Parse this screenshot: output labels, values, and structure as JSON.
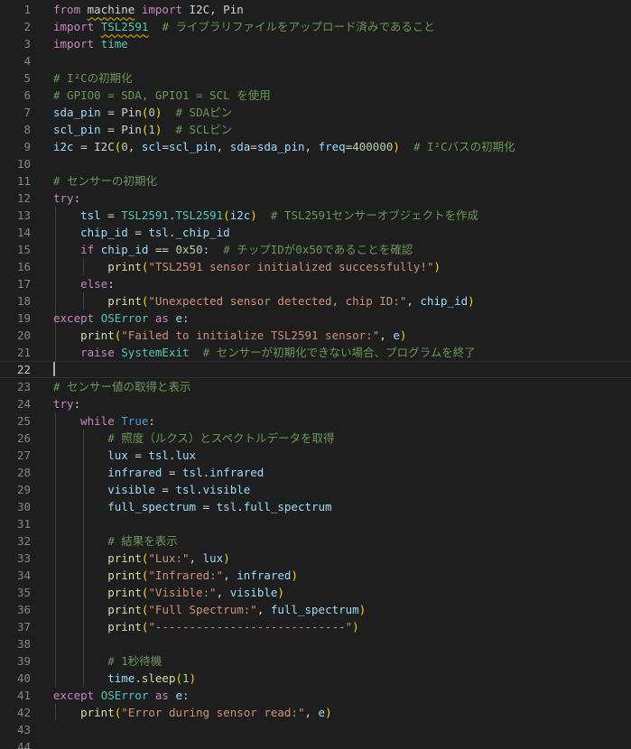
{
  "editor": {
    "language": "python",
    "current_line": 22,
    "lines": [
      [
        [
          "kw",
          "from"
        ],
        [
          "p",
          " "
        ],
        [
          "mod",
          "machine"
        ],
        [
          "p",
          " "
        ],
        [
          "kw",
          "import"
        ],
        [
          "p",
          " I2C, Pin"
        ]
      ],
      [
        [
          "kw",
          "import"
        ],
        [
          "p",
          " "
        ],
        [
          "err",
          "TSL2591"
        ],
        [
          "p",
          "  "
        ],
        [
          "cmt",
          "# ライブラリファイルをアップロード済みであること"
        ]
      ],
      [
        [
          "kw",
          "import"
        ],
        [
          "p",
          " "
        ],
        [
          "cls",
          "time"
        ]
      ],
      [],
      [
        [
          "cmt",
          "# I²Cの初期化"
        ]
      ],
      [
        [
          "cmt",
          "# GPIO0 = SDA, GPIO1 = SCL を使用"
        ]
      ],
      [
        [
          "var",
          "sda_pin"
        ],
        [
          "p",
          " = Pin"
        ],
        [
          "b1",
          "("
        ],
        [
          "num",
          "0"
        ],
        [
          "b1",
          ")"
        ],
        [
          "p",
          "  "
        ],
        [
          "cmt",
          "# SDAピン"
        ]
      ],
      [
        [
          "var",
          "scl_pin"
        ],
        [
          "p",
          " = Pin"
        ],
        [
          "b1",
          "("
        ],
        [
          "num",
          "1"
        ],
        [
          "b1",
          ")"
        ],
        [
          "p",
          "  "
        ],
        [
          "cmt",
          "# SCLピン"
        ]
      ],
      [
        [
          "var",
          "i2c"
        ],
        [
          "p",
          " = I2C"
        ],
        [
          "b1",
          "("
        ],
        [
          "num",
          "0"
        ],
        [
          "p",
          ", "
        ],
        [
          "var",
          "scl"
        ],
        [
          "p",
          "="
        ],
        [
          "var",
          "scl_pin"
        ],
        [
          "p",
          ", "
        ],
        [
          "var",
          "sda"
        ],
        [
          "p",
          "="
        ],
        [
          "var",
          "sda_pin"
        ],
        [
          "p",
          ", "
        ],
        [
          "var",
          "freq"
        ],
        [
          "p",
          "="
        ],
        [
          "num",
          "400000"
        ],
        [
          "b1",
          ")"
        ],
        [
          "p",
          "  "
        ],
        [
          "cmt",
          "# I²Cバスの初期化"
        ]
      ],
      [],
      [
        [
          "cmt",
          "# センサーの初期化"
        ]
      ],
      [
        [
          "ctl",
          "try"
        ],
        [
          "p",
          ":"
        ]
      ],
      [
        [
          "p",
          "    "
        ],
        [
          "var",
          "tsl"
        ],
        [
          "p",
          " = "
        ],
        [
          "cls",
          "TSL2591"
        ],
        [
          "p",
          "."
        ],
        [
          "cls",
          "TSL2591"
        ],
        [
          "b1",
          "("
        ],
        [
          "var",
          "i2c"
        ],
        [
          "b1",
          ")"
        ],
        [
          "p",
          "  "
        ],
        [
          "cmt",
          "# TSL2591センサーオブジェクトを作成"
        ]
      ],
      [
        [
          "p",
          "    "
        ],
        [
          "var",
          "chip_id"
        ],
        [
          "p",
          " = "
        ],
        [
          "var",
          "tsl"
        ],
        [
          "p",
          "."
        ],
        [
          "var",
          "_chip_id"
        ]
      ],
      [
        [
          "p",
          "    "
        ],
        [
          "ctl",
          "if"
        ],
        [
          "p",
          " "
        ],
        [
          "var",
          "chip_id"
        ],
        [
          "p",
          " == "
        ],
        [
          "num",
          "0x50"
        ],
        [
          "p",
          ":  "
        ],
        [
          "cmt",
          "# チップIDが0x50であることを確認"
        ]
      ],
      [
        [
          "p",
          "        "
        ],
        [
          "fn",
          "print"
        ],
        [
          "b1",
          "("
        ],
        [
          "str",
          "\"TSL2591 sensor initialized successfully!\""
        ],
        [
          "b1",
          ")"
        ]
      ],
      [
        [
          "p",
          "    "
        ],
        [
          "ctl",
          "else"
        ],
        [
          "p",
          ":"
        ]
      ],
      [
        [
          "p",
          "        "
        ],
        [
          "fn",
          "print"
        ],
        [
          "b1",
          "("
        ],
        [
          "str",
          "\"Unexpected sensor detected, chip ID:\""
        ],
        [
          "p",
          ", "
        ],
        [
          "var",
          "chip_id"
        ],
        [
          "b1",
          ")"
        ]
      ],
      [
        [
          "ctl",
          "except"
        ],
        [
          "p",
          " "
        ],
        [
          "cls",
          "OSError"
        ],
        [
          "p",
          " "
        ],
        [
          "ctl",
          "as"
        ],
        [
          "p",
          " "
        ],
        [
          "var",
          "e"
        ],
        [
          "p",
          ":"
        ]
      ],
      [
        [
          "p",
          "    "
        ],
        [
          "fn",
          "print"
        ],
        [
          "b1",
          "("
        ],
        [
          "str",
          "\"Failed to initialize TSL2591 sensor:\""
        ],
        [
          "p",
          ", "
        ],
        [
          "var",
          "e"
        ],
        [
          "b1",
          ")"
        ]
      ],
      [
        [
          "p",
          "    "
        ],
        [
          "ctl",
          "raise"
        ],
        [
          "p",
          " "
        ],
        [
          "cls",
          "SystemExit"
        ],
        [
          "p",
          "  "
        ],
        [
          "cmt",
          "# センサーが初期化できない場合、プログラムを終了"
        ]
      ],
      [],
      [
        [
          "cmt",
          "# センサー値の取得と表示"
        ]
      ],
      [
        [
          "ctl",
          "try"
        ],
        [
          "p",
          ":"
        ]
      ],
      [
        [
          "p",
          "    "
        ],
        [
          "ctl",
          "while"
        ],
        [
          "p",
          " "
        ],
        [
          "bool",
          "True"
        ],
        [
          "p",
          ":"
        ]
      ],
      [
        [
          "p",
          "        "
        ],
        [
          "cmt",
          "# 照度（ルクス）とスペクトルデータを取得"
        ]
      ],
      [
        [
          "p",
          "        "
        ],
        [
          "var",
          "lux"
        ],
        [
          "p",
          " = "
        ],
        [
          "var",
          "tsl"
        ],
        [
          "p",
          "."
        ],
        [
          "var",
          "lux"
        ]
      ],
      [
        [
          "p",
          "        "
        ],
        [
          "var",
          "infrared"
        ],
        [
          "p",
          " = "
        ],
        [
          "var",
          "tsl"
        ],
        [
          "p",
          "."
        ],
        [
          "var",
          "infrared"
        ]
      ],
      [
        [
          "p",
          "        "
        ],
        [
          "var",
          "visible"
        ],
        [
          "p",
          " = "
        ],
        [
          "var",
          "tsl"
        ],
        [
          "p",
          "."
        ],
        [
          "var",
          "visible"
        ]
      ],
      [
        [
          "p",
          "        "
        ],
        [
          "var",
          "full_spectrum"
        ],
        [
          "p",
          " = "
        ],
        [
          "var",
          "tsl"
        ],
        [
          "p",
          "."
        ],
        [
          "var",
          "full_spectrum"
        ]
      ],
      [],
      [
        [
          "p",
          "        "
        ],
        [
          "cmt",
          "# 結果を表示"
        ]
      ],
      [
        [
          "p",
          "        "
        ],
        [
          "fn",
          "print"
        ],
        [
          "b1",
          "("
        ],
        [
          "str",
          "\"Lux:\""
        ],
        [
          "p",
          ", "
        ],
        [
          "var",
          "lux"
        ],
        [
          "b1",
          ")"
        ]
      ],
      [
        [
          "p",
          "        "
        ],
        [
          "fn",
          "print"
        ],
        [
          "b1",
          "("
        ],
        [
          "str",
          "\"Infrared:\""
        ],
        [
          "p",
          ", "
        ],
        [
          "var",
          "infrared"
        ],
        [
          "b1",
          ")"
        ]
      ],
      [
        [
          "p",
          "        "
        ],
        [
          "fn",
          "print"
        ],
        [
          "b1",
          "("
        ],
        [
          "str",
          "\"Visible:\""
        ],
        [
          "p",
          ", "
        ],
        [
          "var",
          "visible"
        ],
        [
          "b1",
          ")"
        ]
      ],
      [
        [
          "p",
          "        "
        ],
        [
          "fn",
          "print"
        ],
        [
          "b1",
          "("
        ],
        [
          "str",
          "\"Full Spectrum:\""
        ],
        [
          "p",
          ", "
        ],
        [
          "var",
          "full_spectrum"
        ],
        [
          "b1",
          ")"
        ]
      ],
      [
        [
          "p",
          "        "
        ],
        [
          "fn",
          "print"
        ],
        [
          "b1",
          "("
        ],
        [
          "str",
          "\"----------------------------\""
        ],
        [
          "b1",
          ")"
        ]
      ],
      [],
      [
        [
          "p",
          "        "
        ],
        [
          "cmt",
          "# 1秒待機"
        ]
      ],
      [
        [
          "p",
          "        "
        ],
        [
          "var",
          "time"
        ],
        [
          "p",
          "."
        ],
        [
          "fn",
          "sleep"
        ],
        [
          "b1",
          "("
        ],
        [
          "num",
          "1"
        ],
        [
          "b1",
          ")"
        ]
      ],
      [
        [
          "ctl",
          "except"
        ],
        [
          "p",
          " "
        ],
        [
          "cls",
          "OSError"
        ],
        [
          "p",
          " "
        ],
        [
          "ctl",
          "as"
        ],
        [
          "p",
          " "
        ],
        [
          "var",
          "e"
        ],
        [
          "p",
          ":"
        ]
      ],
      [
        [
          "p",
          "    "
        ],
        [
          "fn",
          "print"
        ],
        [
          "b1",
          "("
        ],
        [
          "str",
          "\"Error during sensor read:\""
        ],
        [
          "p",
          ", "
        ],
        [
          "var",
          "e"
        ],
        [
          "b1",
          ")"
        ]
      ],
      [],
      []
    ]
  },
  "colors": {
    "background": "#1e1e1e",
    "line_number": "#858585",
    "keyword": "#c586c0",
    "function": "#dcdcaa",
    "variable": "#9cdcfe",
    "class": "#4ec9b0",
    "string": "#ce9178",
    "number": "#b5cea8",
    "comment": "#6a9955",
    "bracket": "#ffd700"
  }
}
